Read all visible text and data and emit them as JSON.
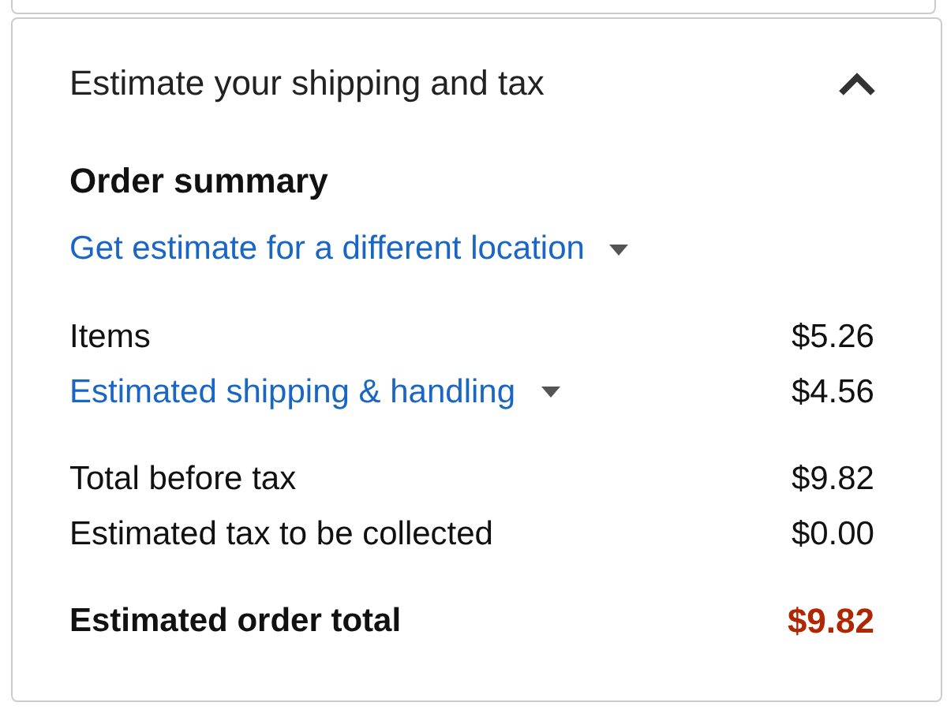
{
  "panel": {
    "title": "Estimate your shipping and tax",
    "expanded": true
  },
  "summary": {
    "heading": "Order summary",
    "location_link": "Get estimate for a different location",
    "groups": [
      [
        {
          "label": "Items",
          "value": "$5.26",
          "kind": "plain"
        },
        {
          "label": "Estimated shipping & handling",
          "value": "$4.56",
          "kind": "link"
        }
      ],
      [
        {
          "label": "Total before tax",
          "value": "$9.82",
          "kind": "plain"
        },
        {
          "label": "Estimated tax to be collected",
          "value": "$0.00",
          "kind": "plain"
        }
      ],
      [
        {
          "label": "Estimated order total",
          "value": "$9.82",
          "kind": "total"
        }
      ]
    ]
  }
}
